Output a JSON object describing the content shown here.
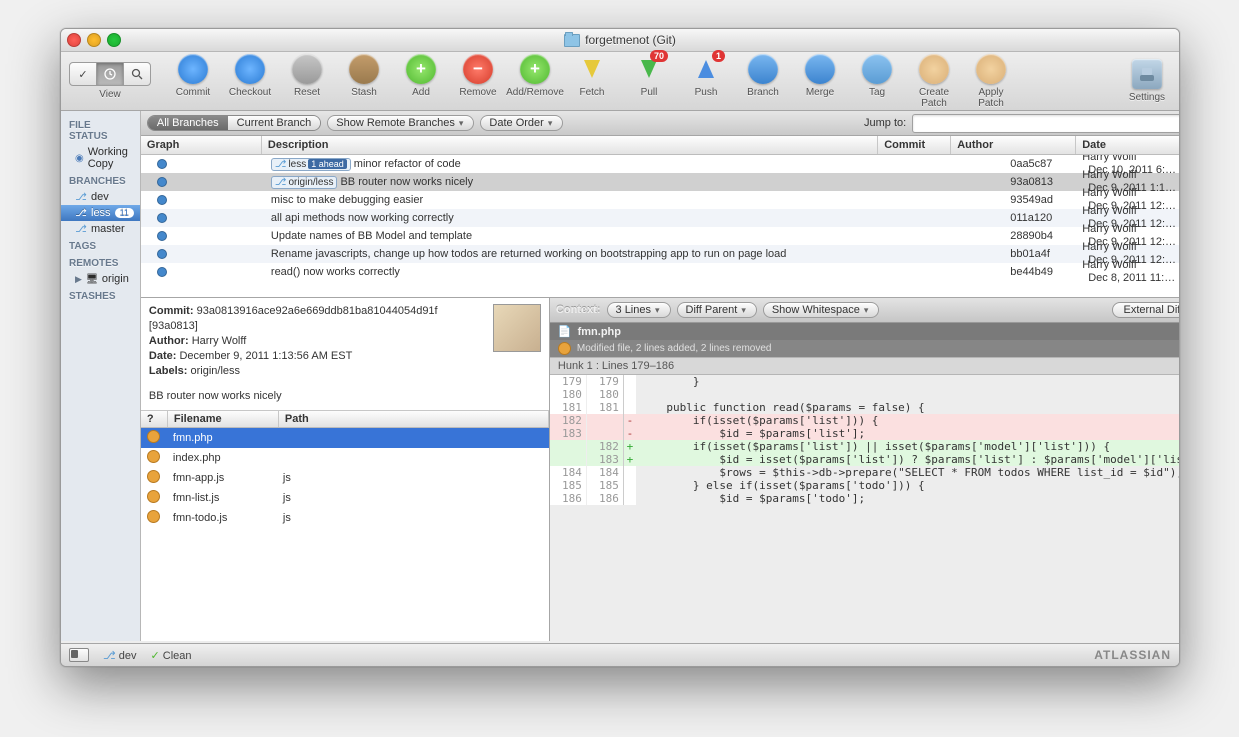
{
  "title": "forgetmenot (Git)",
  "toolbar": {
    "view_label": "View",
    "items": [
      {
        "id": "commit",
        "label": "Commit"
      },
      {
        "id": "checkout",
        "label": "Checkout"
      },
      {
        "id": "reset",
        "label": "Reset"
      },
      {
        "id": "stash",
        "label": "Stash"
      },
      {
        "id": "add",
        "label": "Add"
      },
      {
        "id": "remove",
        "label": "Remove"
      },
      {
        "id": "addremove",
        "label": "Add/Remove"
      },
      {
        "id": "fetch",
        "label": "Fetch"
      },
      {
        "id": "pull",
        "label": "Pull",
        "badge": "70"
      },
      {
        "id": "push",
        "label": "Push",
        "badge": "1"
      },
      {
        "id": "branch",
        "label": "Branch"
      },
      {
        "id": "merge",
        "label": "Merge"
      },
      {
        "id": "tag",
        "label": "Tag"
      },
      {
        "id": "createpatch",
        "label": "Create Patch"
      },
      {
        "id": "applypatch",
        "label": "Apply Patch"
      }
    ],
    "settings_label": "Settings"
  },
  "sidebar": {
    "file_status_head": "FILE STATUS",
    "working_copy": "Working Copy",
    "branches_head": "BRANCHES",
    "branches": [
      {
        "name": "dev",
        "badge": ""
      },
      {
        "name": "less",
        "badge": "11"
      },
      {
        "name": "master",
        "badge": ""
      }
    ],
    "tags_head": "TAGS",
    "remotes_head": "REMOTES",
    "remote": "origin",
    "stashes_head": "STASHES"
  },
  "filterbar": {
    "all_branches": "All Branches",
    "current_branch": "Current Branch",
    "show_remote": "Show Remote Branches",
    "date_order": "Date Order",
    "jump_label": "Jump to:"
  },
  "columns": {
    "graph": "Graph",
    "desc": "Description",
    "commit": "Commit",
    "author": "Author",
    "date": "Date"
  },
  "commits": [
    {
      "refs": [
        "less"
      ],
      "ahead": "1 ahead",
      "msg": "minor refactor of code",
      "hash": "0aa5c87",
      "author": "Harry Wolff <hsw…",
      "date": "Dec 10, 2011 6:…"
    },
    {
      "refs": [
        "origin/less"
      ],
      "msg": "BB router now works nicely",
      "hash": "93a0813",
      "author": "Harry Wolff <hsw…",
      "date": "Dec 9, 2011 1:1…"
    },
    {
      "msg": "misc to make debugging easier",
      "hash": "93549ad",
      "author": "Harry Wolff <hsw…",
      "date": "Dec 9, 2011 12:…"
    },
    {
      "msg": "all api methods now working correctly",
      "hash": "011a120",
      "author": "Harry Wolff <hsw…",
      "date": "Dec 9, 2011 12:…"
    },
    {
      "msg": "Update names of BB Model and template",
      "hash": "28890b4",
      "author": "Harry Wolff <hsw…",
      "date": "Dec 9, 2011 12:…"
    },
    {
      "msg": "Rename javascripts, change up how todos are returned working on bootstrapping app to run on page load",
      "hash": "bb01a4f",
      "author": "Harry Wolff <hsw…",
      "date": "Dec 9, 2011 12:…"
    },
    {
      "msg": "read() now works correctly",
      "hash": "be44b49",
      "author": "Harry Wolff <hsw…",
      "date": "Dec 8, 2011 11:…"
    }
  ],
  "info": {
    "commit_lbl": "Commit:",
    "commit": "93a0813916ace92a6e669ddb81ba81044054d91f",
    "short": "[93a0813]",
    "author_lbl": "Author:",
    "author": "Harry Wolff",
    "date_lbl": "Date:",
    "date": "December 9, 2011 1:13:56 AM EST",
    "labels_lbl": "Labels:",
    "labels": "origin/less",
    "message": "BB router now works nicely"
  },
  "file_cols": {
    "q": "?",
    "name": "Filename",
    "path": "Path"
  },
  "files": [
    {
      "name": "fmn.php",
      "path": ""
    },
    {
      "name": "index.php",
      "path": ""
    },
    {
      "name": "fmn-app.js",
      "path": "js"
    },
    {
      "name": "fmn-list.js",
      "path": "js"
    },
    {
      "name": "fmn-todo.js",
      "path": "js"
    }
  ],
  "diffbar": {
    "context_lbl": "Context:",
    "context_val": "3 Lines",
    "diff_parent": "Diff Parent",
    "show_ws": "Show Whitespace",
    "external": "External Diff"
  },
  "diff_file": {
    "name": "fmn.php",
    "summary": "Modified file, 2 lines added, 2 lines removed",
    "hunk": "Hunk 1 : Lines 179–186"
  },
  "diff_lines": [
    {
      "a": "179",
      "b": "179",
      "t": " ",
      "c": "        }"
    },
    {
      "a": "180",
      "b": "180",
      "t": " ",
      "c": ""
    },
    {
      "a": "181",
      "b": "181",
      "t": " ",
      "c": "    public function read($params = false) {"
    },
    {
      "a": "182",
      "b": "",
      "t": "-",
      "c": "        if(isset($params['list'])) {"
    },
    {
      "a": "183",
      "b": "",
      "t": "-",
      "c": "            $id = $params['list'];"
    },
    {
      "a": "",
      "b": "182",
      "t": "+",
      "c": "        if(isset($params['list']) || isset($params['model']['list'])) {"
    },
    {
      "a": "",
      "b": "183",
      "t": "+",
      "c": "            $id = isset($params['list']) ? $params['list'] : $params['model']['list'"
    },
    {
      "a": "184",
      "b": "184",
      "t": " ",
      "c": "            $rows = $this->db->prepare(\"SELECT * FROM todos WHERE list_id = $id\");"
    },
    {
      "a": "185",
      "b": "185",
      "t": " ",
      "c": "        } else if(isset($params['todo'])) {"
    },
    {
      "a": "186",
      "b": "186",
      "t": " ",
      "c": "            $id = $params['todo'];"
    }
  ],
  "status": {
    "branch": "dev",
    "clean": "Clean",
    "brand": "ATLASSIAN"
  }
}
